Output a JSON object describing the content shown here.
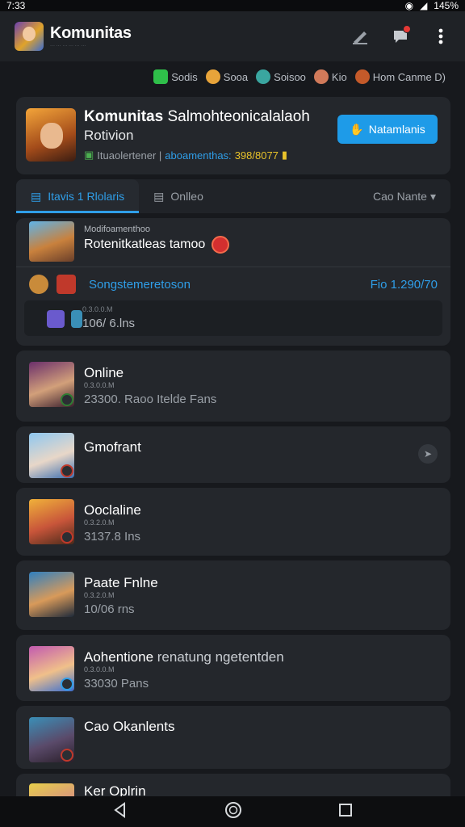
{
  "status_bar": {
    "time": "7:33",
    "battery": "145%"
  },
  "header": {
    "app_title": "Komunitas",
    "app_subtitle": "··· ··· ··· ··· ··· ···"
  },
  "chips": [
    {
      "label": "Sodis",
      "color": "#2fbf4a"
    },
    {
      "label": "Sooa",
      "color": "#e8a43a"
    },
    {
      "label": "Soisoo",
      "color": "#3aa6a0"
    },
    {
      "label": "Kio",
      "color": "#d17a5a"
    },
    {
      "label": "Hom Canme D)",
      "color": "#c45a2a"
    }
  ],
  "featured": {
    "title_bold": "Komunitas",
    "title_rest": "Salmohteonicalalaoh",
    "subtitle": "Rotivion",
    "meta_prefix": "Ituaolertener |",
    "meta_blue": "aboamenthas:",
    "meta_yellow": "398/8077",
    "button_label": "Natamlanis"
  },
  "tabs": {
    "active_label": "Itavis 1 Rlolaris",
    "second_label": "Onlleo",
    "sort_label": "Cao Nante"
  },
  "group_card": {
    "meta": "Modifoamenthoo",
    "title": "Rotenitkatleas tamoo",
    "row_label": "Songstemeretoson",
    "row_value": "Fio 1.290/70",
    "inner_meta": "0.3.0.0.M",
    "inner_value": "106/ 6.lns"
  },
  "rows": [
    {
      "name": "Online",
      "small": "0.3.0.0.M",
      "detail": "23300. Raoo Itelde Fans"
    },
    {
      "name": "Gmofrant",
      "small": "",
      "detail": ""
    },
    {
      "name": "Ooclaline",
      "small": "0.3.2.0.M",
      "detail": "3137.8 Ins"
    },
    {
      "name": "Paate Fnlne",
      "small": "0.3.2.0.M",
      "detail": "10/06 rns"
    },
    {
      "name": "Aohentione",
      "name_rest": "renatung ngetentden",
      "small": "0.3.0.0.M",
      "detail": "33030 Pans"
    },
    {
      "name": "Cao Okanlents",
      "small": "",
      "detail": ""
    },
    {
      "name": "Ker Oplrin",
      "small": "",
      "detail": ""
    }
  ]
}
